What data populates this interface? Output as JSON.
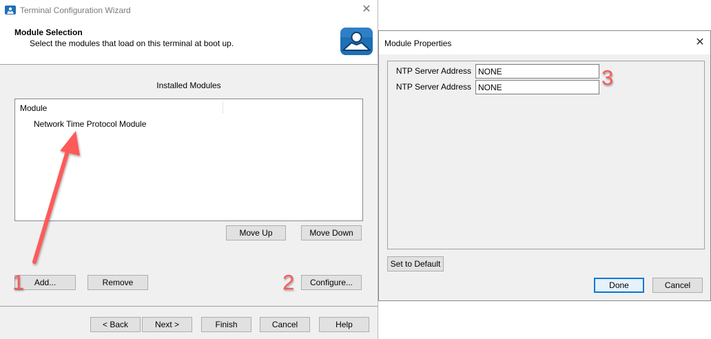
{
  "wizard": {
    "title": "Terminal Configuration Wizard",
    "close_icon": "close-icon",
    "header": {
      "title": "Module Selection",
      "subtitle": "Select the modules that load on this terminal at boot up.",
      "logo_icon": "terminal-user-logo"
    },
    "installed_label": "Installed Modules",
    "list": {
      "column_header": "Module",
      "items": [
        "Network Time Protocol Module"
      ]
    },
    "buttons": {
      "move_up": "Move Up",
      "move_down": "Move Down",
      "add": "Add...",
      "remove": "Remove",
      "configure": "Configure..."
    },
    "footer": {
      "back": "< Back",
      "next": "Next >",
      "finish": "Finish",
      "cancel": "Cancel",
      "help": "Help"
    }
  },
  "properties": {
    "title": "Module Properties",
    "close_icon": "close-icon",
    "fields": [
      {
        "label": "NTP Server Address",
        "value": "NONE"
      },
      {
        "label": "NTP Server Address",
        "value": "NONE"
      }
    ],
    "buttons": {
      "set_default": "Set to Default",
      "done": "Done",
      "cancel": "Cancel"
    }
  },
  "annotations": {
    "step1": "1",
    "step2": "2",
    "step3": "3",
    "color": "#ff5a5a"
  },
  "colors": {
    "logo_blue": "#1f6fb6",
    "focus_blue": "#0078d7"
  }
}
